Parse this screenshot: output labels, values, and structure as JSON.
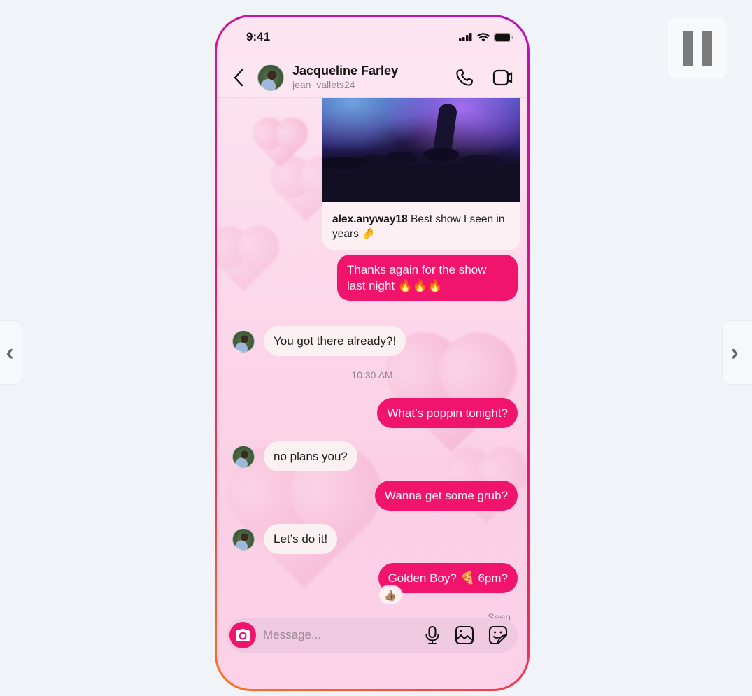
{
  "controls": {
    "prev_label": "‹",
    "next_label": "›",
    "pause_icon": "pause-icon"
  },
  "colors": {
    "accent": "#f0146d",
    "incoming_bubble": "#fbf1f3",
    "border_gradient": [
      "#b80fbf",
      "#ee1a6c",
      "#f77a1c"
    ]
  },
  "status_bar": {
    "time": "9:41",
    "icons": [
      "signal-icon",
      "wifi-icon",
      "battery-icon"
    ]
  },
  "header": {
    "back_icon": "chevron-left-icon",
    "name": "Jacqueline Farley",
    "handle": "jean_vallets24",
    "actions": [
      "phone-icon",
      "video-camera-icon"
    ]
  },
  "shared_post": {
    "username": "alex.anyway18",
    "caption": " Best show I seen in years 🤌"
  },
  "messages": [
    {
      "direction": "out",
      "text": "Thanks again for the show last night 🔥🔥🔥"
    },
    {
      "direction": "in",
      "text": "You got there already?!"
    },
    {
      "type": "timestamp",
      "text": "10:30 AM"
    },
    {
      "direction": "out",
      "text": "What’s poppin tonight?"
    },
    {
      "direction": "in",
      "text": "no plans you?"
    },
    {
      "direction": "out",
      "text": "Wanna get some grub?"
    },
    {
      "direction": "in",
      "text": "Let’s do it!"
    },
    {
      "direction": "out",
      "text": "Golden Boy? 🍕 6pm?",
      "reaction": "👍🏽"
    }
  ],
  "seen_label": "Seen",
  "composer": {
    "placeholder": "Message...",
    "value": "",
    "icons": [
      "camera-icon",
      "microphone-icon",
      "gallery-icon",
      "sticker-icon"
    ]
  }
}
